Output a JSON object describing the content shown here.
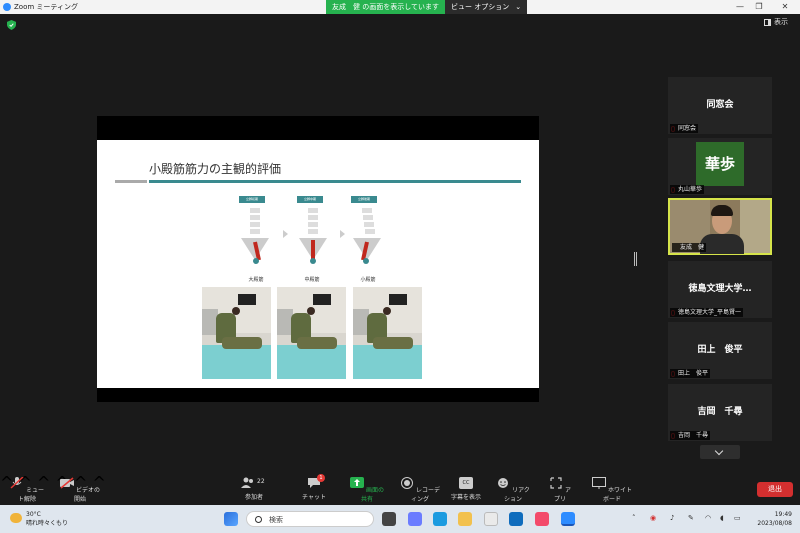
{
  "window": {
    "title": "Zoom ミーティング",
    "share_banner": "友成　健 の画面を表示しています",
    "view_options": "ビュー オプション",
    "controls": [
      "—",
      "❐",
      "✕"
    ]
  },
  "view_button": "表示",
  "slide": {
    "title": "小殿筋筋力の主観的評価",
    "tags": [
      "立脚初期",
      "立脚中期",
      "立脚後期"
    ],
    "muscles": [
      "大殿筋",
      "中殿筋",
      "小殿筋"
    ]
  },
  "participants": [
    {
      "display": "同窓会",
      "label": "同窓会",
      "type": "name"
    },
    {
      "display": "華歩",
      "label": "丸山華歩",
      "type": "avatar",
      "color": "#2e6b2a"
    },
    {
      "display": "",
      "label": "友成　健",
      "type": "video"
    },
    {
      "display": "徳島文理大学…",
      "label": "徳島文理大学_平島賢一",
      "type": "name"
    },
    {
      "display": "田上　俊平",
      "label": "田上　俊平",
      "type": "name"
    },
    {
      "display": "吉岡　千尋",
      "label": "吉岡　千尋",
      "type": "name"
    }
  ],
  "toolbar": {
    "mute": "ミュート解除",
    "video": "ビデオの開始",
    "participants": "参加者",
    "participants_count": "22",
    "chat": "チャット",
    "chat_badge": "1",
    "share": "画面の共有",
    "record": "レコーディング",
    "captions": "字幕を表示",
    "cc": "CC",
    "reactions": "リアクション",
    "apps": "アプリ",
    "whiteboard": "ホワイトボード",
    "leave": "退出"
  },
  "taskbar": {
    "temperature": "30°C",
    "weather": "晴れ時々くもり",
    "search_placeholder": "検索",
    "time": "19:49",
    "date": "2023/08/08"
  },
  "colors": {
    "share_green": "#26b24f",
    "leave_red": "#d32f2f",
    "slide_teal": "#3a8a8f",
    "active_speaker": "#d6e44a"
  }
}
